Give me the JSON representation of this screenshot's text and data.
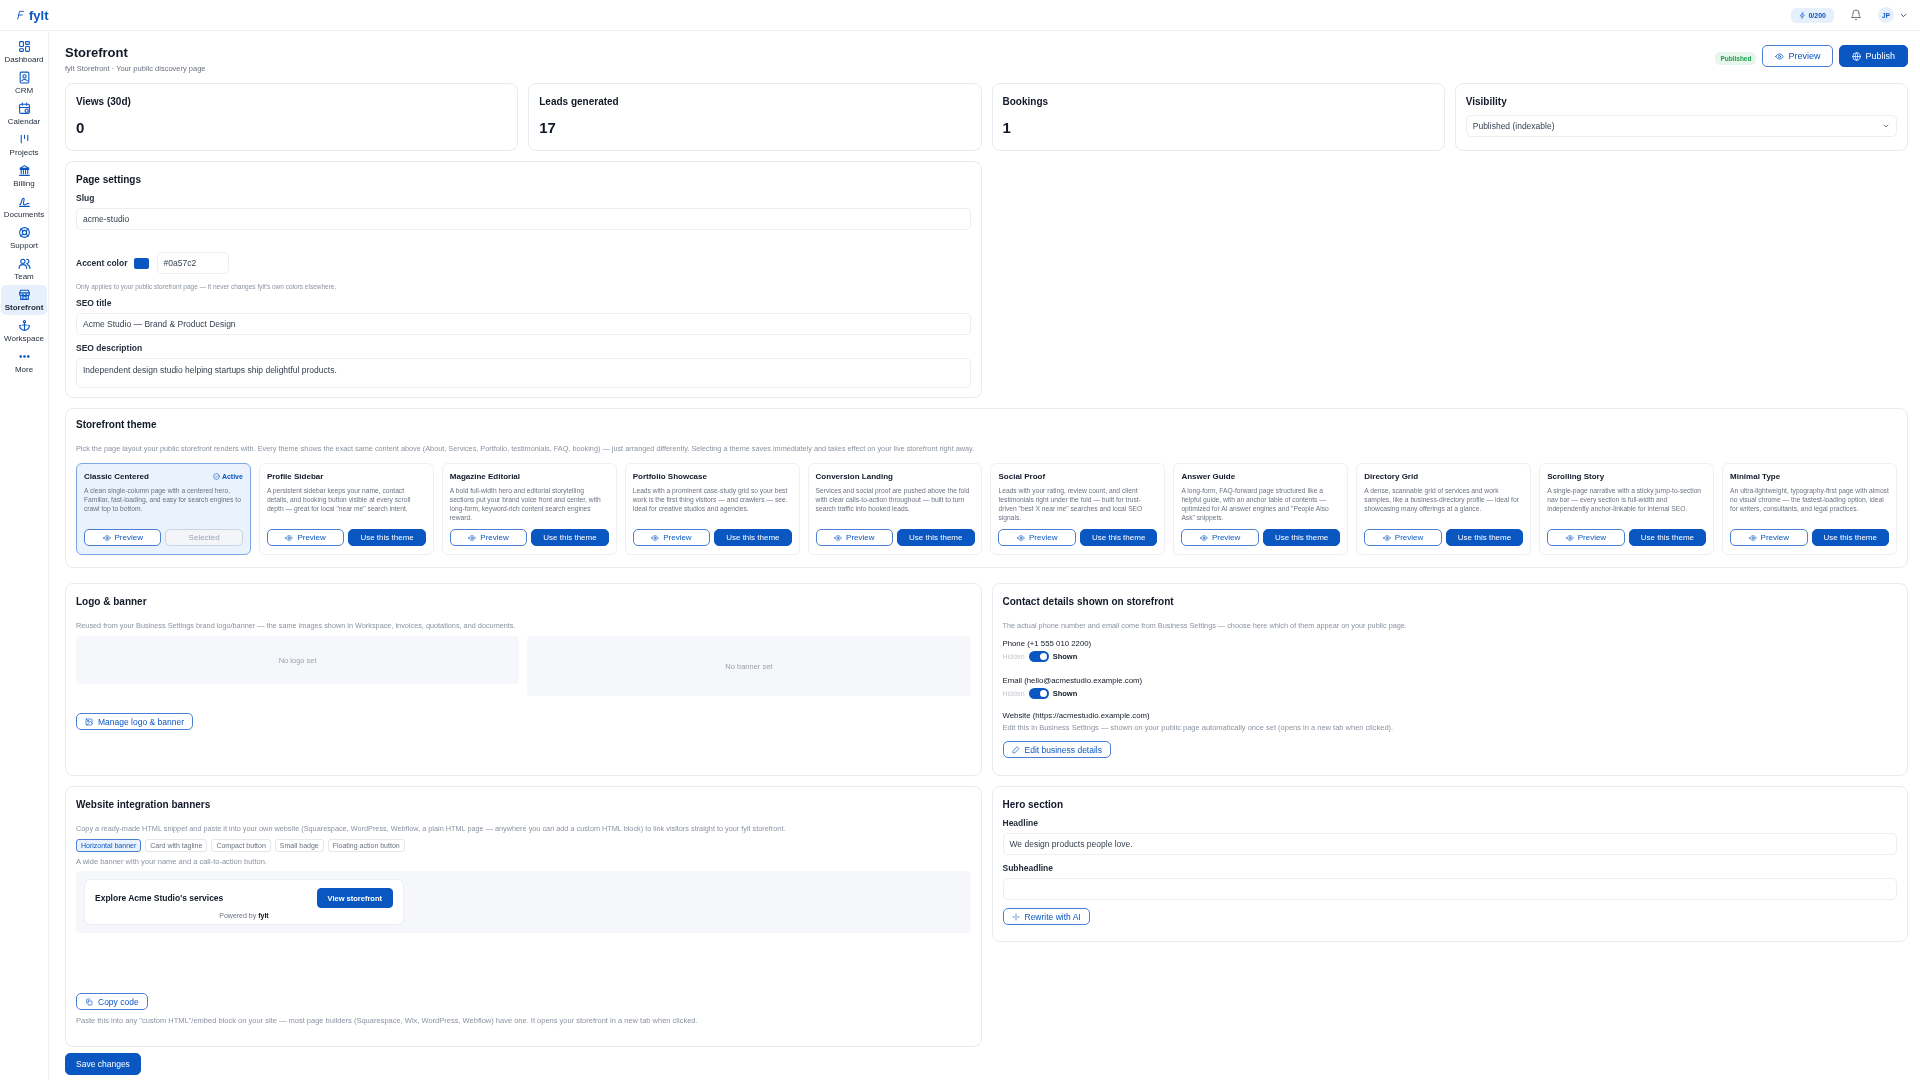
{
  "app": {
    "logo": "fylt",
    "credits": "0/200",
    "avatar": "JP"
  },
  "sidebar": {
    "items": [
      {
        "label": "Dashboard",
        "selected": false
      },
      {
        "label": "CRM",
        "selected": false
      },
      {
        "label": "Calendar",
        "selected": false
      },
      {
        "label": "Projects",
        "selected": false
      },
      {
        "label": "Billing",
        "selected": false
      },
      {
        "label": "Documents",
        "selected": false
      },
      {
        "label": "Support",
        "selected": false
      },
      {
        "label": "Team",
        "selected": false
      },
      {
        "label": "Storefront",
        "selected": true
      },
      {
        "label": "Workspace",
        "selected": false
      },
      {
        "label": "More",
        "selected": false
      }
    ]
  },
  "page": {
    "title": "Storefront",
    "subtitle": "fylt Storefront · Your public discovery page",
    "status": "Published",
    "preview": "Preview",
    "publish": "Publish"
  },
  "stats": [
    {
      "label": "Views (30d)",
      "value": "0"
    },
    {
      "label": "Leads generated",
      "value": "17"
    },
    {
      "label": "Bookings",
      "value": "1"
    }
  ],
  "visibility": {
    "label": "Visibility",
    "value": "Published (indexable)"
  },
  "page_settings": {
    "title": "Page settings",
    "slug_label": "Slug",
    "slug": "acme-studio",
    "accent_label": "Accent color",
    "accent_value": "#0a57c2",
    "accent_hint": "Only applies to your public storefront page — it never changes fylt's own colors elsewhere.",
    "seo_title_label": "SEO title",
    "seo_title": "Acme Studio — Brand & Product Design",
    "seo_description_label": "SEO description",
    "seo_description": "Independent design studio helping startups ship delightful products."
  },
  "themes": {
    "title": "Storefront theme",
    "intro": "Pick the page layout your public storefront renders with. Every theme shows the exact same content above (About, Services, Portfolio, testimonials, FAQ, booking) — just arranged differently. Selecting a theme saves immediately and takes effect on your live storefront right away.",
    "items": [
      {
        "name": "Classic Centered",
        "badge": "Active",
        "description": "A clean single-column page with a centered hero. Familiar, fast-loading, and easy for search engines to crawl top to bottom.",
        "preview": "Preview",
        "action": "Selected",
        "selected": true
      },
      {
        "name": "Profile Sidebar",
        "description": "A persistent sidebar keeps your name, contact details, and booking button visible at every scroll depth — great for local \"near me\" search intent.",
        "preview": "Preview",
        "action": "Use this theme",
        "selected": false
      },
      {
        "name": "Magazine Editorial",
        "description": "A bold full-width hero and editorial storytelling sections put your brand voice front and center, with long-form, keyword-rich content search engines reward.",
        "preview": "Preview",
        "action": "Use this theme",
        "selected": false
      },
      {
        "name": "Portfolio Showcase",
        "description": "Leads with a prominent case-study grid so your best work is the first thing visitors — and crawlers — see. Ideal for creative studios and agencies.",
        "preview": "Preview",
        "action": "Use this theme",
        "selected": false
      },
      {
        "name": "Conversion Landing",
        "description": "Services and social proof are pushed above the fold with clear calls-to-action throughout — built to turn search traffic into booked leads.",
        "preview": "Preview",
        "action": "Use this theme",
        "selected": false
      },
      {
        "name": "Social Proof",
        "description": "Leads with your rating, review count, and client testimonials right under the fold — built for trust-driven \"best X near me\" searches and local SEO signals.",
        "preview": "Preview",
        "action": "Use this theme",
        "selected": false
      },
      {
        "name": "Answer Guide",
        "description": "A long-form, FAQ-forward page structured like a helpful guide, with an anchor table of contents — optimized for AI answer engines and \"People Also Ask\" snippets.",
        "preview": "Preview",
        "action": "Use this theme",
        "selected": false
      },
      {
        "name": "Directory Grid",
        "description": "A dense, scannable grid of services and work samples, like a business-directory profile — ideal for showcasing many offerings at a glance.",
        "preview": "Preview",
        "action": "Use this theme",
        "selected": false
      },
      {
        "name": "Scrolling Story",
        "description": "A single-page narrative with a sticky jump-to-section nav bar — every section is full-width and independently anchor-linkable for internal SEO.",
        "preview": "Preview",
        "action": "Use this theme",
        "selected": false
      },
      {
        "name": "Minimal Type",
        "description": "An ultra-lightweight, typography-first page with almost no visual chrome — the fastest-loading option, ideal for writers, consultants, and legal practices.",
        "preview": "Preview",
        "action": "Use this theme",
        "selected": false
      }
    ]
  },
  "logo_banner": {
    "title": "Logo & banner",
    "intro": "Reused from your Business Settings brand logo/banner — the same images shown in Workspace, invoices, quotations, and documents.",
    "logo_placeholder": "No logo set",
    "banner_placeholder": "No banner set",
    "button": "Manage logo & banner"
  },
  "contact": {
    "title": "Contact details shown on storefront",
    "intro": "The actual phone number and email come from Business Settings — choose here which of them appear on your public page.",
    "toggles": [
      {
        "label": "Phone (+1 555 010 2200)",
        "off_label": "Hidden",
        "on_label": "Shown",
        "on": true
      },
      {
        "label": "Email (hello@acmestudio.example.com)",
        "off_label": "Hidden",
        "on_label": "Shown",
        "on": true
      }
    ],
    "website": "Website (https://acmestudio.example.com)",
    "website_hint": "Edit this in Business Settings — shown on your public page automatically once set (opens in a new tab when clicked).",
    "button": "Edit business details"
  },
  "integration": {
    "title": "Website integration banners",
    "intro": "Copy a ready-made HTML snippet and paste it into your own website (Squarespace, WordPress, Webflow, a plain HTML page — anywhere you can add a custom HTML block) to link visitors straight to your fylt storefront.",
    "styles": [
      {
        "label": "Horizontal banner",
        "selected": true
      },
      {
        "label": "Card with tagline",
        "selected": false
      },
      {
        "label": "Compact button",
        "selected": false
      },
      {
        "label": "Small badge",
        "selected": false
      },
      {
        "label": "Floating action button",
        "selected": false
      }
    ],
    "style_hint": "A wide banner with your name and a call-to-action button.",
    "preview": {
      "heading": "Explore Acme Studio's services",
      "button": "View storefront",
      "powered_by": "Powered by",
      "brand": "fylt"
    },
    "copy": "Copy code",
    "note": "Paste this into any \"custom HTML\"/embed block on your site — most page builders (Squarespace, Wix, WordPress, Webflow) have one. It opens your storefront in a new tab when clicked."
  },
  "hero": {
    "title": "Hero section",
    "headline_label": "Headline",
    "headline": "We design products people love.",
    "subheadline_label": "Subheadline",
    "button": "Rewrite with AI"
  },
  "save": "Save changes"
}
